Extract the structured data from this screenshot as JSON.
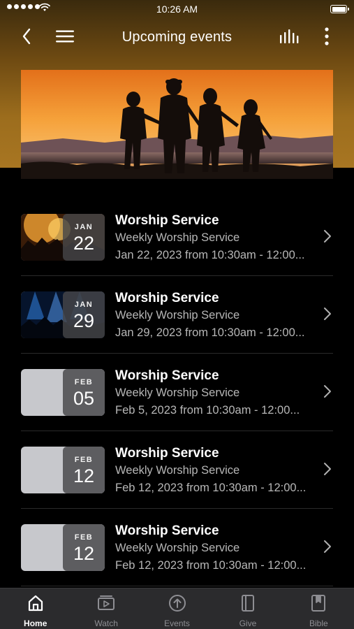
{
  "status_bar": {
    "time": "10:26 AM"
  },
  "nav": {
    "title": "Upcoming events",
    "icons": [
      "back-arrow-icon",
      "menu-icon",
      "equalizer-icon",
      "more-vertical-icon"
    ]
  },
  "hero": {
    "image": "sunset-family-silhouette"
  },
  "events": [
    {
      "title": "Worship Service",
      "subtitle": "Weekly Worship Service",
      "when": "Jan 22, 2023 from 10:30am - 12:00...",
      "month": "JAN",
      "day": "22",
      "thumb": "concert-orange"
    },
    {
      "title": "Worship Service",
      "subtitle": "Weekly Worship Service",
      "when": "Jan 29, 2023 from 10:30am - 12:00...",
      "month": "JAN",
      "day": "29",
      "thumb": "concert-blue"
    },
    {
      "title": "Worship Service",
      "subtitle": "Weekly Worship Service",
      "when": "Feb 5, 2023 from 10:30am - 12:00...",
      "month": "FEB",
      "day": "05",
      "thumb": "placeholder-gray"
    },
    {
      "title": "Worship Service",
      "subtitle": "Weekly Worship Service",
      "when": "Feb 12, 2023 from 10:30am - 12:00...",
      "month": "FEB",
      "day": "12",
      "thumb": "placeholder-gray"
    },
    {
      "title": "Worship Service",
      "subtitle": "Weekly Worship Service",
      "when": "Feb 12, 2023 from 10:30am - 12:00...",
      "month": "FEB",
      "day": "12",
      "thumb": "placeholder-gray"
    }
  ],
  "tabs": [
    {
      "label": "Home",
      "icon": "home-icon",
      "active": true
    },
    {
      "label": "Watch",
      "icon": "video-icon",
      "active": false
    },
    {
      "label": "Events",
      "icon": "arrow-up-circle-icon",
      "active": false
    },
    {
      "label": "Give",
      "icon": "give-icon",
      "active": false
    },
    {
      "label": "Bible",
      "icon": "bookmark-book-icon",
      "active": false
    }
  ],
  "colors": {
    "header_gold": "#9c6d1d",
    "tab_bar": "#2b2b2d",
    "muted_text": "#b7b7b7",
    "inactive_tab": "#8e8e93"
  }
}
